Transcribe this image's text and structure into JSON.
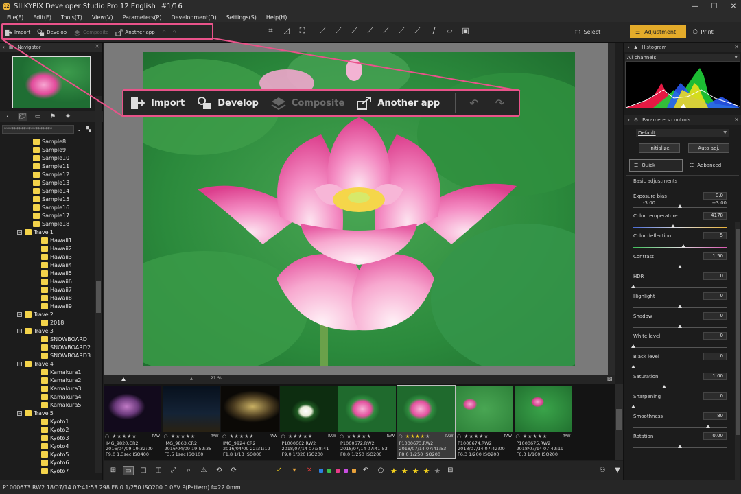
{
  "window": {
    "title": "SILKYPIX Developer Studio Pro 12 English",
    "page_index": "#1/16"
  },
  "menu": [
    "File(F)",
    "Edit(E)",
    "Tools(T)",
    "View(V)",
    "Parameters(P)",
    "Development(D)",
    "Settings(S)",
    "Help(H)"
  ],
  "toolbar": {
    "import": "Import",
    "develop": "Develop",
    "composite": "Composite",
    "another_app": "Another app"
  },
  "modes": {
    "select": "Select",
    "adjustment": "Adjustment",
    "print": "Print"
  },
  "navigator": {
    "title": "Navigator"
  },
  "folder_path": "********************",
  "tree": [
    {
      "label": "Sample8",
      "level": 2
    },
    {
      "label": "Sample9",
      "level": 2
    },
    {
      "label": "Sample10",
      "level": 2
    },
    {
      "label": "Sample11",
      "level": 2
    },
    {
      "label": "Sample12",
      "level": 2
    },
    {
      "label": "Sample13",
      "level": 2
    },
    {
      "label": "Sample14",
      "level": 2
    },
    {
      "label": "Sample15",
      "level": 2
    },
    {
      "label": "Sample16",
      "level": 2
    },
    {
      "label": "Sample17",
      "level": 2
    },
    {
      "label": "Sample18",
      "level": 2
    },
    {
      "label": "Travel1",
      "level": 1,
      "expander": "−"
    },
    {
      "label": "Hawaii1",
      "level": 3
    },
    {
      "label": "Hawaii2",
      "level": 3
    },
    {
      "label": "Hawaii3",
      "level": 3
    },
    {
      "label": "Hawaii4",
      "level": 3
    },
    {
      "label": "Hawaii5",
      "level": 3
    },
    {
      "label": "Hawaii6",
      "level": 3
    },
    {
      "label": "Hawaii7",
      "level": 3
    },
    {
      "label": "Hawaii8",
      "level": 3
    },
    {
      "label": "Hawaii9",
      "level": 3
    },
    {
      "label": "Travel2",
      "level": 1,
      "expander": "−"
    },
    {
      "label": "2018",
      "level": 3
    },
    {
      "label": "Travel3",
      "level": 1,
      "expander": "−"
    },
    {
      "label": "SNOWBOARD",
      "level": 3
    },
    {
      "label": "SNOWBOARD2",
      "level": 3
    },
    {
      "label": "SNOWBOARD3",
      "level": 3
    },
    {
      "label": "Travel4",
      "level": 1,
      "expander": "−"
    },
    {
      "label": "Kamakura1",
      "level": 3
    },
    {
      "label": "Kamakura2",
      "level": 3
    },
    {
      "label": "Kamakura3",
      "level": 3
    },
    {
      "label": "Kamakura4",
      "level": 3
    },
    {
      "label": "Kamakura5",
      "level": 3
    },
    {
      "label": "Travel5",
      "level": 1,
      "expander": "−"
    },
    {
      "label": "Kyoto1",
      "level": 3
    },
    {
      "label": "Kyoto2",
      "level": 3
    },
    {
      "label": "Kyoto3",
      "level": 3
    },
    {
      "label": "Kyoto4",
      "level": 3
    },
    {
      "label": "Kyoto5",
      "level": 3
    },
    {
      "label": "Kyoto6",
      "level": 3
    },
    {
      "label": "Kyoto7",
      "level": 3
    }
  ],
  "zoom_value": "21",
  "zoom_unit": "%",
  "filmstrip": [
    {
      "name": "IMG_9820.CR2",
      "date": "2016/04/09 19:32:09",
      "exif": "F9.0 1.3sec ISO400",
      "stars": 0,
      "kind": "night-pink"
    },
    {
      "name": "IMG_9863.CR2",
      "date": "2016/04/09 19:52:35",
      "exif": "F3.5 1sec ISO100",
      "stars": 0,
      "kind": "night-street"
    },
    {
      "name": "IMG_9924.CR2",
      "date": "2016/04/09 22:31:19",
      "exif": "F1.8 1/13 ISO800",
      "stars": 0,
      "kind": "night-tree"
    },
    {
      "name": "P1000662.RW2",
      "date": "2018/07/14 07:38:41",
      "exif": "F9.0 1/320 ISO200",
      "stars": 0,
      "kind": "white-lotus"
    },
    {
      "name": "P1000672.RW2",
      "date": "2018/07/14 07:41:53",
      "exif": "F8.0 1/250 ISO200",
      "stars": 0,
      "kind": "pink-lotus"
    },
    {
      "name": "P1000673.RW2",
      "date": "2018/07/14 07:41:53",
      "exif": "F8.0 1/250 ISO200",
      "stars": 4,
      "kind": "pink-lotus-sel",
      "selected": true
    },
    {
      "name": "P1000674.RW2",
      "date": "2018/07/14 07:42:00",
      "exif": "F6.3 1/200 ISO200",
      "stars": 0,
      "kind": "pink-small"
    },
    {
      "name": "P1000675.RW2",
      "date": "2018/07/14 07:42:19",
      "exif": "F6.3 1/160 ISO200",
      "stars": 0,
      "kind": "pink-small2"
    }
  ],
  "raw_badge": "RAW",
  "status": "P1000673.RW2 18/07/14 07:41:53.298 F8.0 1/250 ISO200  0.0EV P(Pattern) f=22.0mm",
  "right": {
    "histogram_title": "Histogram",
    "channel": "All channels",
    "param_controls_title": "Parameters controls",
    "preset": "Default",
    "initialize": "Initialize",
    "auto_adj": "Auto adj.",
    "quick": "Quick",
    "advanced": "Adbanced",
    "basic_adjustments": "Basic adjustments",
    "exposure_min": "-3.00",
    "exposure_max": "+3.00"
  },
  "params": [
    {
      "label": "Exposure bias",
      "value": "0.0",
      "pos": 0.5
    },
    {
      "label": "Color temperature",
      "value": "4178",
      "pos": 0.43
    },
    {
      "label": "Color deflection",
      "value": "5",
      "pos": 0.54
    },
    {
      "label": "Contrast",
      "value": "1.50",
      "pos": 0.5
    },
    {
      "label": "HDR",
      "value": "0",
      "pos": 0.0
    },
    {
      "label": "Highlight",
      "value": "0",
      "pos": 0.5
    },
    {
      "label": "Shadow",
      "value": "0",
      "pos": 0.5
    },
    {
      "label": "White level",
      "value": "0",
      "pos": 0.0
    },
    {
      "label": "Black level",
      "value": "0",
      "pos": 0.0
    },
    {
      "label": "Saturation",
      "value": "1.00",
      "pos": 0.33
    },
    {
      "label": "Sharpening",
      "value": "0",
      "pos": 0.0
    },
    {
      "label": "Smoothness",
      "value": "80",
      "pos": 0.8
    },
    {
      "label": "Rotation",
      "value": "0.00",
      "pos": 0.5
    }
  ]
}
